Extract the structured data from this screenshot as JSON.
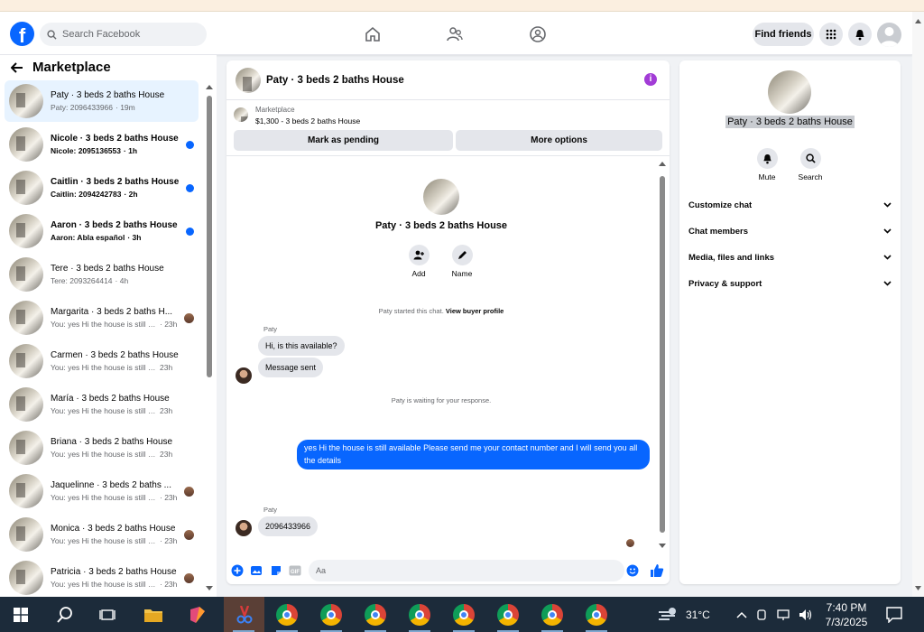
{
  "app": {
    "search_placeholder": "Search Facebook",
    "find_friends": "Find friends",
    "logo_letter": "f"
  },
  "sidebar": {
    "title": "Marketplace",
    "conversations": [
      {
        "name": "Paty · 3 beds 2 baths House",
        "msg": "Paty: 2096433966",
        "time": "· 19m",
        "active": true,
        "unread": false,
        "badge": "none"
      },
      {
        "name": "Nicole · 3 beds 2 baths House",
        "msg": "Nicole: 2095136553",
        "time": "· 1h",
        "active": false,
        "unread": true,
        "badge": "dot"
      },
      {
        "name": "Caitlin · 3 beds 2 baths House",
        "msg": "Caitlin: 2094242783",
        "time": "· 2h",
        "active": false,
        "unread": true,
        "badge": "dot"
      },
      {
        "name": "Aaron · 3 beds 2 baths House",
        "msg": "Aaron: Abla español",
        "time": "· 3h",
        "active": false,
        "unread": true,
        "badge": "dot"
      },
      {
        "name": "Tere · 3 beds 2 baths House",
        "msg": "Tere: 2093264414",
        "time": "· 4h",
        "active": false,
        "unread": false,
        "badge": "none"
      },
      {
        "name": "Margarita · 3 beds 2 baths H...",
        "msg": "You: yes Hi the house is still av...",
        "time": "· 23h",
        "active": false,
        "unread": false,
        "badge": "avatar"
      },
      {
        "name": "Carmen · 3 beds 2 baths House",
        "msg": "You: yes Hi the house is still avail...",
        "time": "23h",
        "active": false,
        "unread": false,
        "badge": "none"
      },
      {
        "name": "María · 3 beds 2 baths House",
        "msg": "You: yes Hi the house is still avail...",
        "time": "23h",
        "active": false,
        "unread": false,
        "badge": "none"
      },
      {
        "name": "Briana · 3 beds 2 baths House",
        "msg": "You: yes Hi the house is still avail...",
        "time": "23h",
        "active": false,
        "unread": false,
        "badge": "none"
      },
      {
        "name": "Jaquelinne · 3 beds 2 baths ...",
        "msg": "You: yes Hi the house is still av...",
        "time": "· 23h",
        "active": false,
        "unread": false,
        "badge": "avatar"
      },
      {
        "name": "Monica · 3 beds 2 baths House",
        "msg": "You: yes Hi the house is still av...",
        "time": "· 23h",
        "active": false,
        "unread": false,
        "badge": "avatar"
      },
      {
        "name": "Patricia · 3 beds 2 baths House",
        "msg": "You: yes Hi the house is still av...",
        "time": "· 23h",
        "active": false,
        "unread": false,
        "badge": "avatar"
      }
    ]
  },
  "chat": {
    "title": "Paty · 3 beds 2 baths House",
    "marketplace_label": "Marketplace",
    "price_line": "$1,300 - 3 beds 2 baths House",
    "mark_pending": "Mark as pending",
    "more_options": "More options",
    "center_title": "Paty · 3 beds 2 baths House",
    "add_label": "Add",
    "name_label": "Name",
    "started_text": "Paty started this chat.",
    "view_profile": "View buyer profile",
    "sender_1": "Paty",
    "msg_1": "Hi, is this available?",
    "msg_2": "Message sent",
    "waiting": "Paty is waiting for your response.",
    "msg_out": "yes Hi the house is still available Please send me your contact number and I will send you all the details",
    "sender_2": "Paty",
    "msg_3": "2096433966",
    "composer_placeholder": "Aa",
    "gif_label": "GIF"
  },
  "details": {
    "name": "Paty · 3 beds 2 baths House",
    "mute": "Mute",
    "search": "Search",
    "rows": [
      "Customize chat",
      "Chat members",
      "Media, files and links",
      "Privacy & support"
    ]
  },
  "taskbar": {
    "weather": "31°C",
    "time": "7:40 PM",
    "date": "7/3/2025"
  },
  "colors": {
    "accent": "#0866ff",
    "info": "#a23cd6"
  }
}
